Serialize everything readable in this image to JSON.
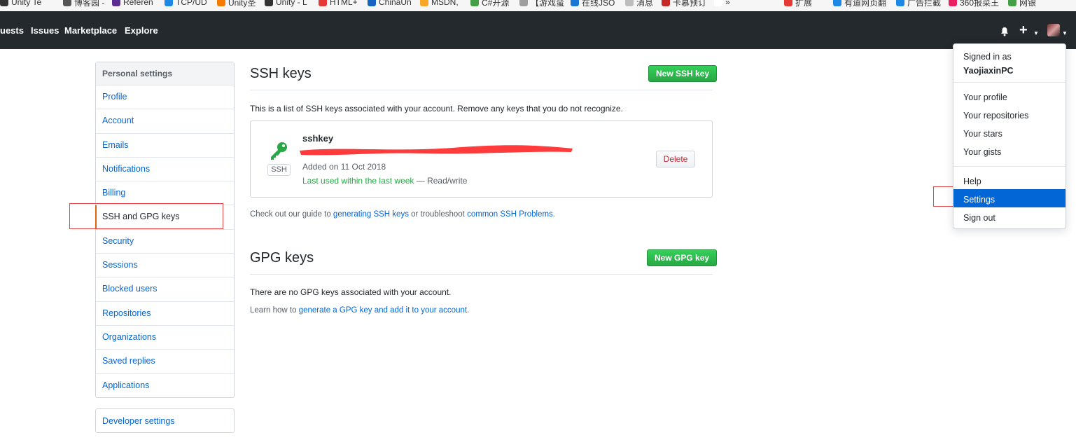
{
  "bookmarks": [
    {
      "label": "Unity Te",
      "color": "#333333"
    },
    {
      "label": "博客园 -",
      "color": "#555555"
    },
    {
      "label": "Referen",
      "color": "#5c2d91"
    },
    {
      "label": "TCP/UD",
      "color": "#1e88e5"
    },
    {
      "label": "Unity圣",
      "color": "#f57c00"
    },
    {
      "label": "Unity - L",
      "color": "#333333"
    },
    {
      "label": "HTML+",
      "color": "#e53935"
    },
    {
      "label": "ChinaUn",
      "color": "#1565c0"
    },
    {
      "label": "MSDN,",
      "color": "#f9a825"
    },
    {
      "label": "C#开源",
      "color": "#43a047"
    },
    {
      "label": "【游戏蛮",
      "color": "#9e9e9e"
    },
    {
      "label": "在线JSO",
      "color": "#1976d2"
    },
    {
      "label": "消息",
      "color": "#bdbdbd"
    },
    {
      "label": "卡慕预订",
      "color": "#c62828"
    },
    {
      "label": "»",
      "color": "#ffffff"
    },
    {
      "label": "扩展",
      "color": "#e53935"
    },
    {
      "label": "有道网页翻",
      "color": "#1e88e5"
    },
    {
      "label": "广告拦截",
      "color": "#1e88e5"
    },
    {
      "label": "360报菜王",
      "color": "#e91e63"
    },
    {
      "label": "网银",
      "color": "#43a047"
    }
  ],
  "header": {
    "nav": [
      "uests",
      "Issues",
      "Marketplace",
      "Explore"
    ]
  },
  "sidebar": {
    "heading": "Personal settings",
    "items": [
      {
        "label": "Profile",
        "name": "sidebar-item-profile"
      },
      {
        "label": "Account",
        "name": "sidebar-item-account"
      },
      {
        "label": "Emails",
        "name": "sidebar-item-emails"
      },
      {
        "label": "Notifications",
        "name": "sidebar-item-notifications"
      },
      {
        "label": "Billing",
        "name": "sidebar-item-billing"
      },
      {
        "label": "SSH and GPG keys",
        "name": "sidebar-item-ssh-gpg-keys"
      },
      {
        "label": "Security",
        "name": "sidebar-item-security"
      },
      {
        "label": "Sessions",
        "name": "sidebar-item-sessions"
      },
      {
        "label": "Blocked users",
        "name": "sidebar-item-blocked-users"
      },
      {
        "label": "Repositories",
        "name": "sidebar-item-repositories"
      },
      {
        "label": "Organizations",
        "name": "sidebar-item-organizations"
      },
      {
        "label": "Saved replies",
        "name": "sidebar-item-saved-replies"
      },
      {
        "label": "Applications",
        "name": "sidebar-item-applications"
      }
    ],
    "active_index": 5,
    "developer_settings": "Developer settings"
  },
  "ssh": {
    "title": "SSH keys",
    "new_button": "New SSH key",
    "intro": "This is a list of SSH keys associated with your account. Remove any keys that you do not recognize.",
    "key": {
      "type_label": "SSH",
      "title": "sshkey",
      "added": "Added on 11 Oct 2018",
      "last_used": "Last used within the last week",
      "access": " — Read/write",
      "delete_label": "Delete"
    },
    "guide_prefix": "Check out our guide to ",
    "guide_link1": "generating SSH keys",
    "guide_middle": " or troubleshoot ",
    "guide_link2": "common SSH Problems",
    "guide_suffix": "."
  },
  "gpg": {
    "title": "GPG keys",
    "new_button": "New GPG key",
    "empty": "There are no GPG keys associated with your account.",
    "learn_prefix": "Learn how to ",
    "learn_link": "generate a GPG key and add it to your account",
    "learn_suffix": "."
  },
  "dropdown": {
    "signed_in_as": "Signed in as",
    "username": "YaojiaxinPC",
    "items_a": [
      "Your profile",
      "Your repositories",
      "Your stars",
      "Your gists"
    ],
    "items_b": [
      "Help",
      "Settings",
      "Sign out"
    ],
    "active": "Settings"
  },
  "colors": {
    "header_bg": "#24292e",
    "link": "#0366d6",
    "green": "#28a745",
    "danger": "#cb2431",
    "annotation_red": "#e64545"
  }
}
